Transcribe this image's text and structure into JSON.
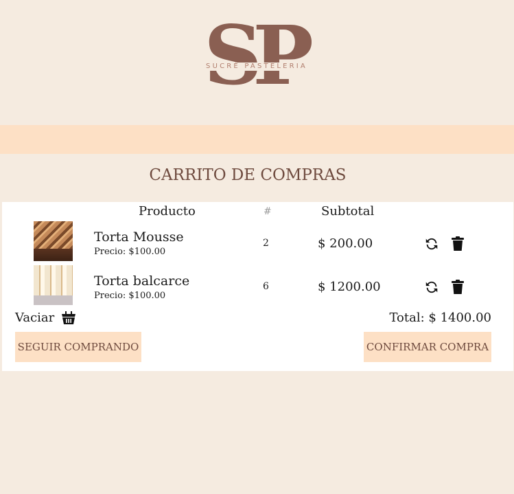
{
  "brand": {
    "logo_letters": "SP",
    "name": "SUCRÉ PASTELERIA"
  },
  "cart": {
    "title": "CARRITO DE COMPRAS",
    "columns": {
      "product": "Producto",
      "qty": "#",
      "subtotal": "Subtotal"
    },
    "items": [
      {
        "name": "Torta Mousse",
        "price": "Precio: $100.00",
        "qty": "2",
        "subtotal": "$ 200.00",
        "thumb": "mousse-cake-photo"
      },
      {
        "name": "Torta balcarce",
        "price": "Precio: $100.00",
        "qty": "6",
        "subtotal": "$ 1200.00",
        "thumb": "balcarce-cake-photo"
      }
    ],
    "empty_label": "Vaciar",
    "total": "Total: $ 1400.00",
    "continue_label": "SEGUIR COMPRANDO",
    "confirm_label": "CONFIRMAR COMPRA"
  },
  "icons": {
    "refresh": "refresh-icon",
    "delete": "trash-icon",
    "empty_cart": "basket-icon"
  },
  "colors": {
    "page_bg": "#f5ebe0",
    "accent": "#fde0c5",
    "brand_brown": "#8a5f52",
    "title_brown": "#6e4a3e"
  }
}
